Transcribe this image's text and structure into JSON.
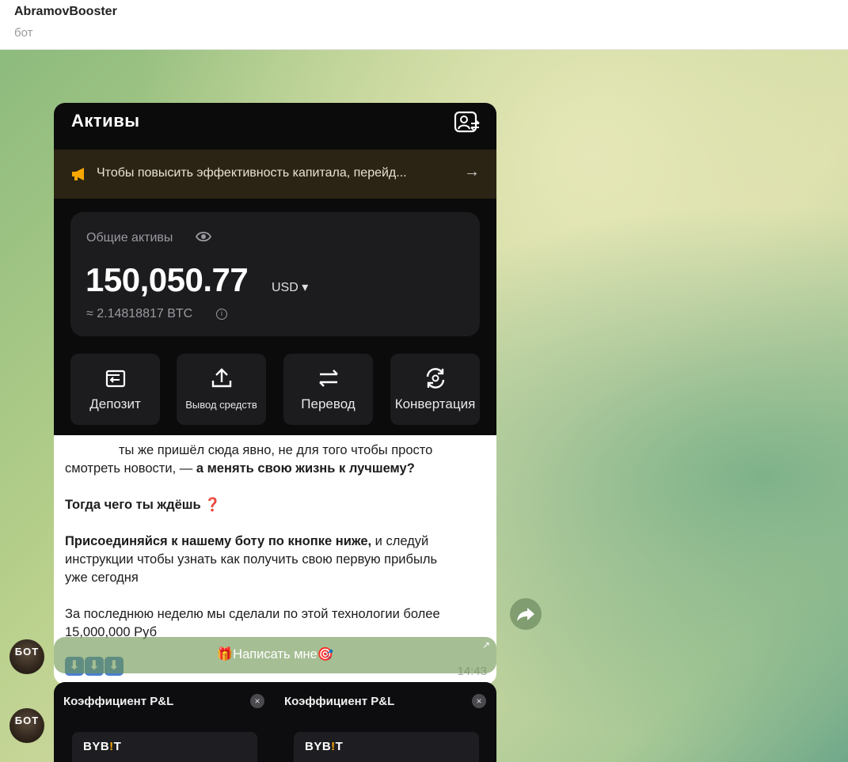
{
  "header": {
    "title": "AbramovBooster",
    "subtitle": "бот"
  },
  "screenshot": {
    "title": "Активы",
    "banner_text": "Чтобы повысить эффективность капитала, перейд...",
    "total_label": "Общие активы",
    "amount": "150,050.77",
    "currency": "USD ▾",
    "btc_equivalent": "≈ 2.14818817 BTC",
    "actions": [
      {
        "label": "Депозит",
        "icon": "deposit-icon"
      },
      {
        "label": "Вывод средств",
        "icon": "withdraw-icon"
      },
      {
        "label": "Перевод",
        "icon": "transfer-icon"
      },
      {
        "label": "Конвертация",
        "icon": "convert-icon"
      }
    ]
  },
  "message": {
    "line1": "ты же пришёл сюда явно, не для того чтобы просто",
    "line2_plain": "смотреть новости, — ",
    "line2_bold": "а менять свою жизнь к лучшему?",
    "question_bold": "Тогда чего ты ждёшь",
    "question_emoji": "❓",
    "join_bold": "Присоединяйся к нашему боту по кнопке ниже,",
    "join_plain": " и следуй",
    "join_line2": "инструкции чтобы узнать как получить свою первую прибыль",
    "join_line3": "уже сегодня",
    "result_line1": "За последнюю неделю мы сделали по этой технологии более",
    "result_line2": "15,000,000 Руб",
    "arrows": [
      "⬇",
      "⬇",
      "⬇"
    ],
    "time": "14:43"
  },
  "avatar_text": "БОТ",
  "inline_button": {
    "label": "🎁Написать мне🎯",
    "corner": "↗"
  },
  "second_message": {
    "cards": [
      {
        "title": "Коэффициент P&L",
        "close": "×",
        "logo_a": "BYB",
        "logo_b": "!",
        "logo_c": "T"
      },
      {
        "title": "Коэффициент P&L",
        "close": "×",
        "logo_a": "BYB",
        "logo_b": "!",
        "logo_c": "T"
      }
    ]
  }
}
